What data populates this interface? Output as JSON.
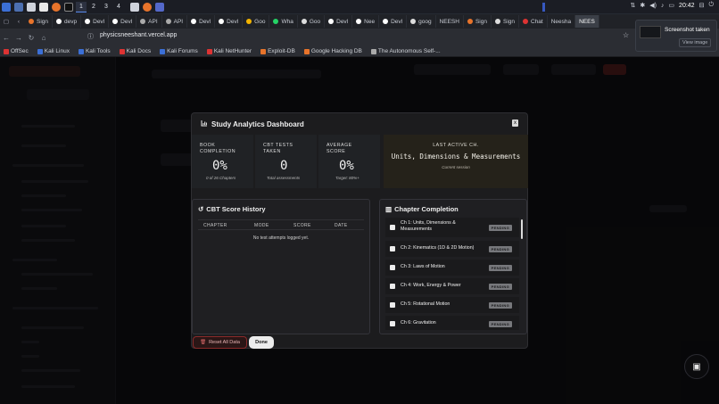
{
  "taskbar": {
    "workspaces": [
      "1",
      "2",
      "3",
      "4"
    ],
    "windows": [
      "Sign",
      "devp",
      "Devl",
      "Devl",
      "API",
      "API",
      "Devl",
      "Devl",
      "Goo",
      "Wha",
      "Goo",
      "Devl",
      "Nee",
      "Devl",
      "goog",
      "NEESH",
      "Sign",
      "Sign",
      "Chat",
      "Neesha",
      "NEES"
    ],
    "time": "20:42"
  },
  "notification": {
    "title": "Screenshot taken",
    "action": "View image"
  },
  "browser": {
    "url": "physicsneeshant.vercel.app",
    "bookmarks": [
      "OffSec",
      "Kali Linux",
      "Kali Tools",
      "Kali Docs",
      "Kali Forums",
      "Kali NetHunter",
      "Exploit-DB",
      "Google Hacking DB",
      "The Autonomous Self-..."
    ]
  },
  "modal": {
    "title": "Study Analytics Dashboard",
    "close": "x",
    "stats": [
      {
        "label": "BOOK COMPLETION",
        "value": "0%",
        "sub": "0 of 26 Chapters"
      },
      {
        "label": "CBT TESTS TAKEN",
        "value": "0",
        "sub": "Total assessments"
      },
      {
        "label": "AVERAGE SCORE",
        "value": "0%",
        "sub": "Target: 80%+"
      }
    ],
    "last_active": {
      "label": "LAST ACTIVE CH.",
      "value": "Units, Dimensions & Measurements",
      "sub": "Current session"
    },
    "history": {
      "title": "CBT Score History",
      "columns": [
        "CHAPTER",
        "MODE",
        "SCORE",
        "DATE"
      ],
      "empty": "No test attempts logged yet."
    },
    "completion": {
      "title": "Chapter Completion",
      "chapters": [
        {
          "name": "Ch 1: Units, Dimensions & Measurements",
          "status": "PENDING"
        },
        {
          "name": "Ch 2: Kinematics (1D & 2D Motion)",
          "status": "PENDING"
        },
        {
          "name": "Ch 3: Laws of Motion",
          "status": "PENDING"
        },
        {
          "name": "Ch 4: Work, Energy & Power",
          "status": "PENDING"
        },
        {
          "name": "Ch 5: Rotational Motion",
          "status": "PENDING"
        },
        {
          "name": "Ch 6: Gravitation",
          "status": "PENDING"
        }
      ]
    },
    "reset_label": "Reset All Data",
    "done_label": "Done"
  },
  "colors": {
    "accent": "#5b8def",
    "pending": "#77787c",
    "danger": "#8a2a2a"
  }
}
